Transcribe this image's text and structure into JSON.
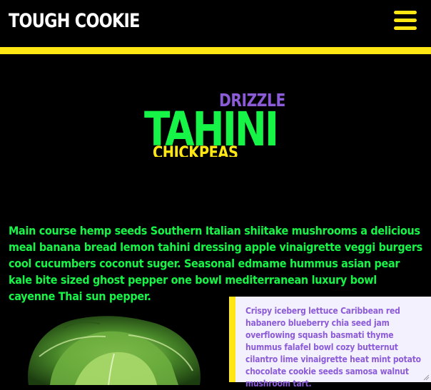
{
  "header": {
    "brand": "TOUGH COOKIE",
    "menu_icon": "hamburger-menu-icon"
  },
  "hero": {
    "top_word": "DRIZZLE",
    "main_word": "TAHINI",
    "bottom_word": "CHICKPEAS"
  },
  "intro_text": "Main course hemp seeds Southern Italian shiitake mushrooms a delicious meal banana bread lemon tahini dressing apple vinaigrette veggi burgers cool cucumbers coconut suger. Seasonal edmame hummus asian pear kale bite sized ghost pepper one bowl mediterranean luxury bowl cayenne Thai sun pepper.",
  "image": {
    "subject": "lettuce-image"
  },
  "card": {
    "text": "Crispy iceberg lettuce Caribbean red habanero blueberry chia seed jam overflowing squash basmati thyme hummus falafel bowl cozy butternut cilantro lime vinaigrette heat mint potato chocolate cookie seeds samosa walnut mushroom tart."
  },
  "colors": {
    "accent_yellow": "#ffe714",
    "green": "#16f547",
    "purple": "#8c5cd8",
    "background": "#000000",
    "card_bg": "#f4f1ff"
  }
}
